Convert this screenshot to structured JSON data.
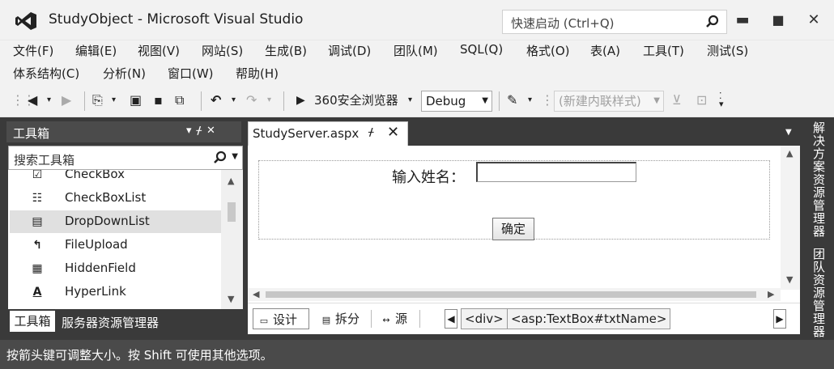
{
  "title_bar": {
    "app_title": "StudyObject - Microsoft Visual Studio",
    "quick_launch_placeholder": "快速启动 (Ctrl+Q)",
    "logo_icon": "visual-studio-logo-icon"
  },
  "window_controls": {
    "minimize": "▬",
    "maximize": "■",
    "close": "✕"
  },
  "menu": {
    "row1": [
      "文件(F)",
      "编辑(E)",
      "视图(V)",
      "网站(S)",
      "生成(B)",
      "调试(D)",
      "团队(M)",
      "SQL(Q)",
      "格式(O)",
      "表(A)",
      "工具(T)",
      "测试(S)"
    ],
    "row2": [
      "体系结构(C)",
      "分析(N)",
      "窗口(W)",
      "帮助(H)"
    ]
  },
  "toolbar": {
    "run_target": "360安全浏览器",
    "configuration": "Debug",
    "style_combo": "(新建内联样式)"
  },
  "toolbox": {
    "title": "工具箱",
    "search_placeholder": "搜索工具箱",
    "items": [
      {
        "label": "CheckBox",
        "icon": "checkbox-icon",
        "glyph": "☑"
      },
      {
        "label": "CheckBoxList",
        "icon": "checkboxlist-icon",
        "glyph": "☷"
      },
      {
        "label": "DropDownList",
        "icon": "dropdownlist-icon",
        "glyph": "▤",
        "selected": true
      },
      {
        "label": "FileUpload",
        "icon": "fileupload-icon",
        "glyph": "↰"
      },
      {
        "label": "HiddenField",
        "icon": "hiddenfield-icon",
        "glyph": "▦"
      },
      {
        "label": "HyperLink",
        "icon": "hyperlink-icon",
        "glyph": "A"
      }
    ],
    "bottom_tabs": {
      "active": "工具箱",
      "other": "服务器资源管理器"
    }
  },
  "document": {
    "tab_label": "StudyServer.aspx",
    "form": {
      "name_label": "输入姓名：",
      "name_value": "",
      "submit_label": "确定"
    },
    "view_buttons": {
      "design": "设计",
      "split": "拆分",
      "source": "源"
    },
    "breadcrumb": [
      "<div>",
      "<asp:TextBox#txtName>"
    ]
  },
  "side_tabs": [
    "解决方案资源管理器",
    "团队资源管理器"
  ],
  "status_bar": {
    "text": "按箭头键可调整大小。按 Shift 可使用其他选项。"
  }
}
